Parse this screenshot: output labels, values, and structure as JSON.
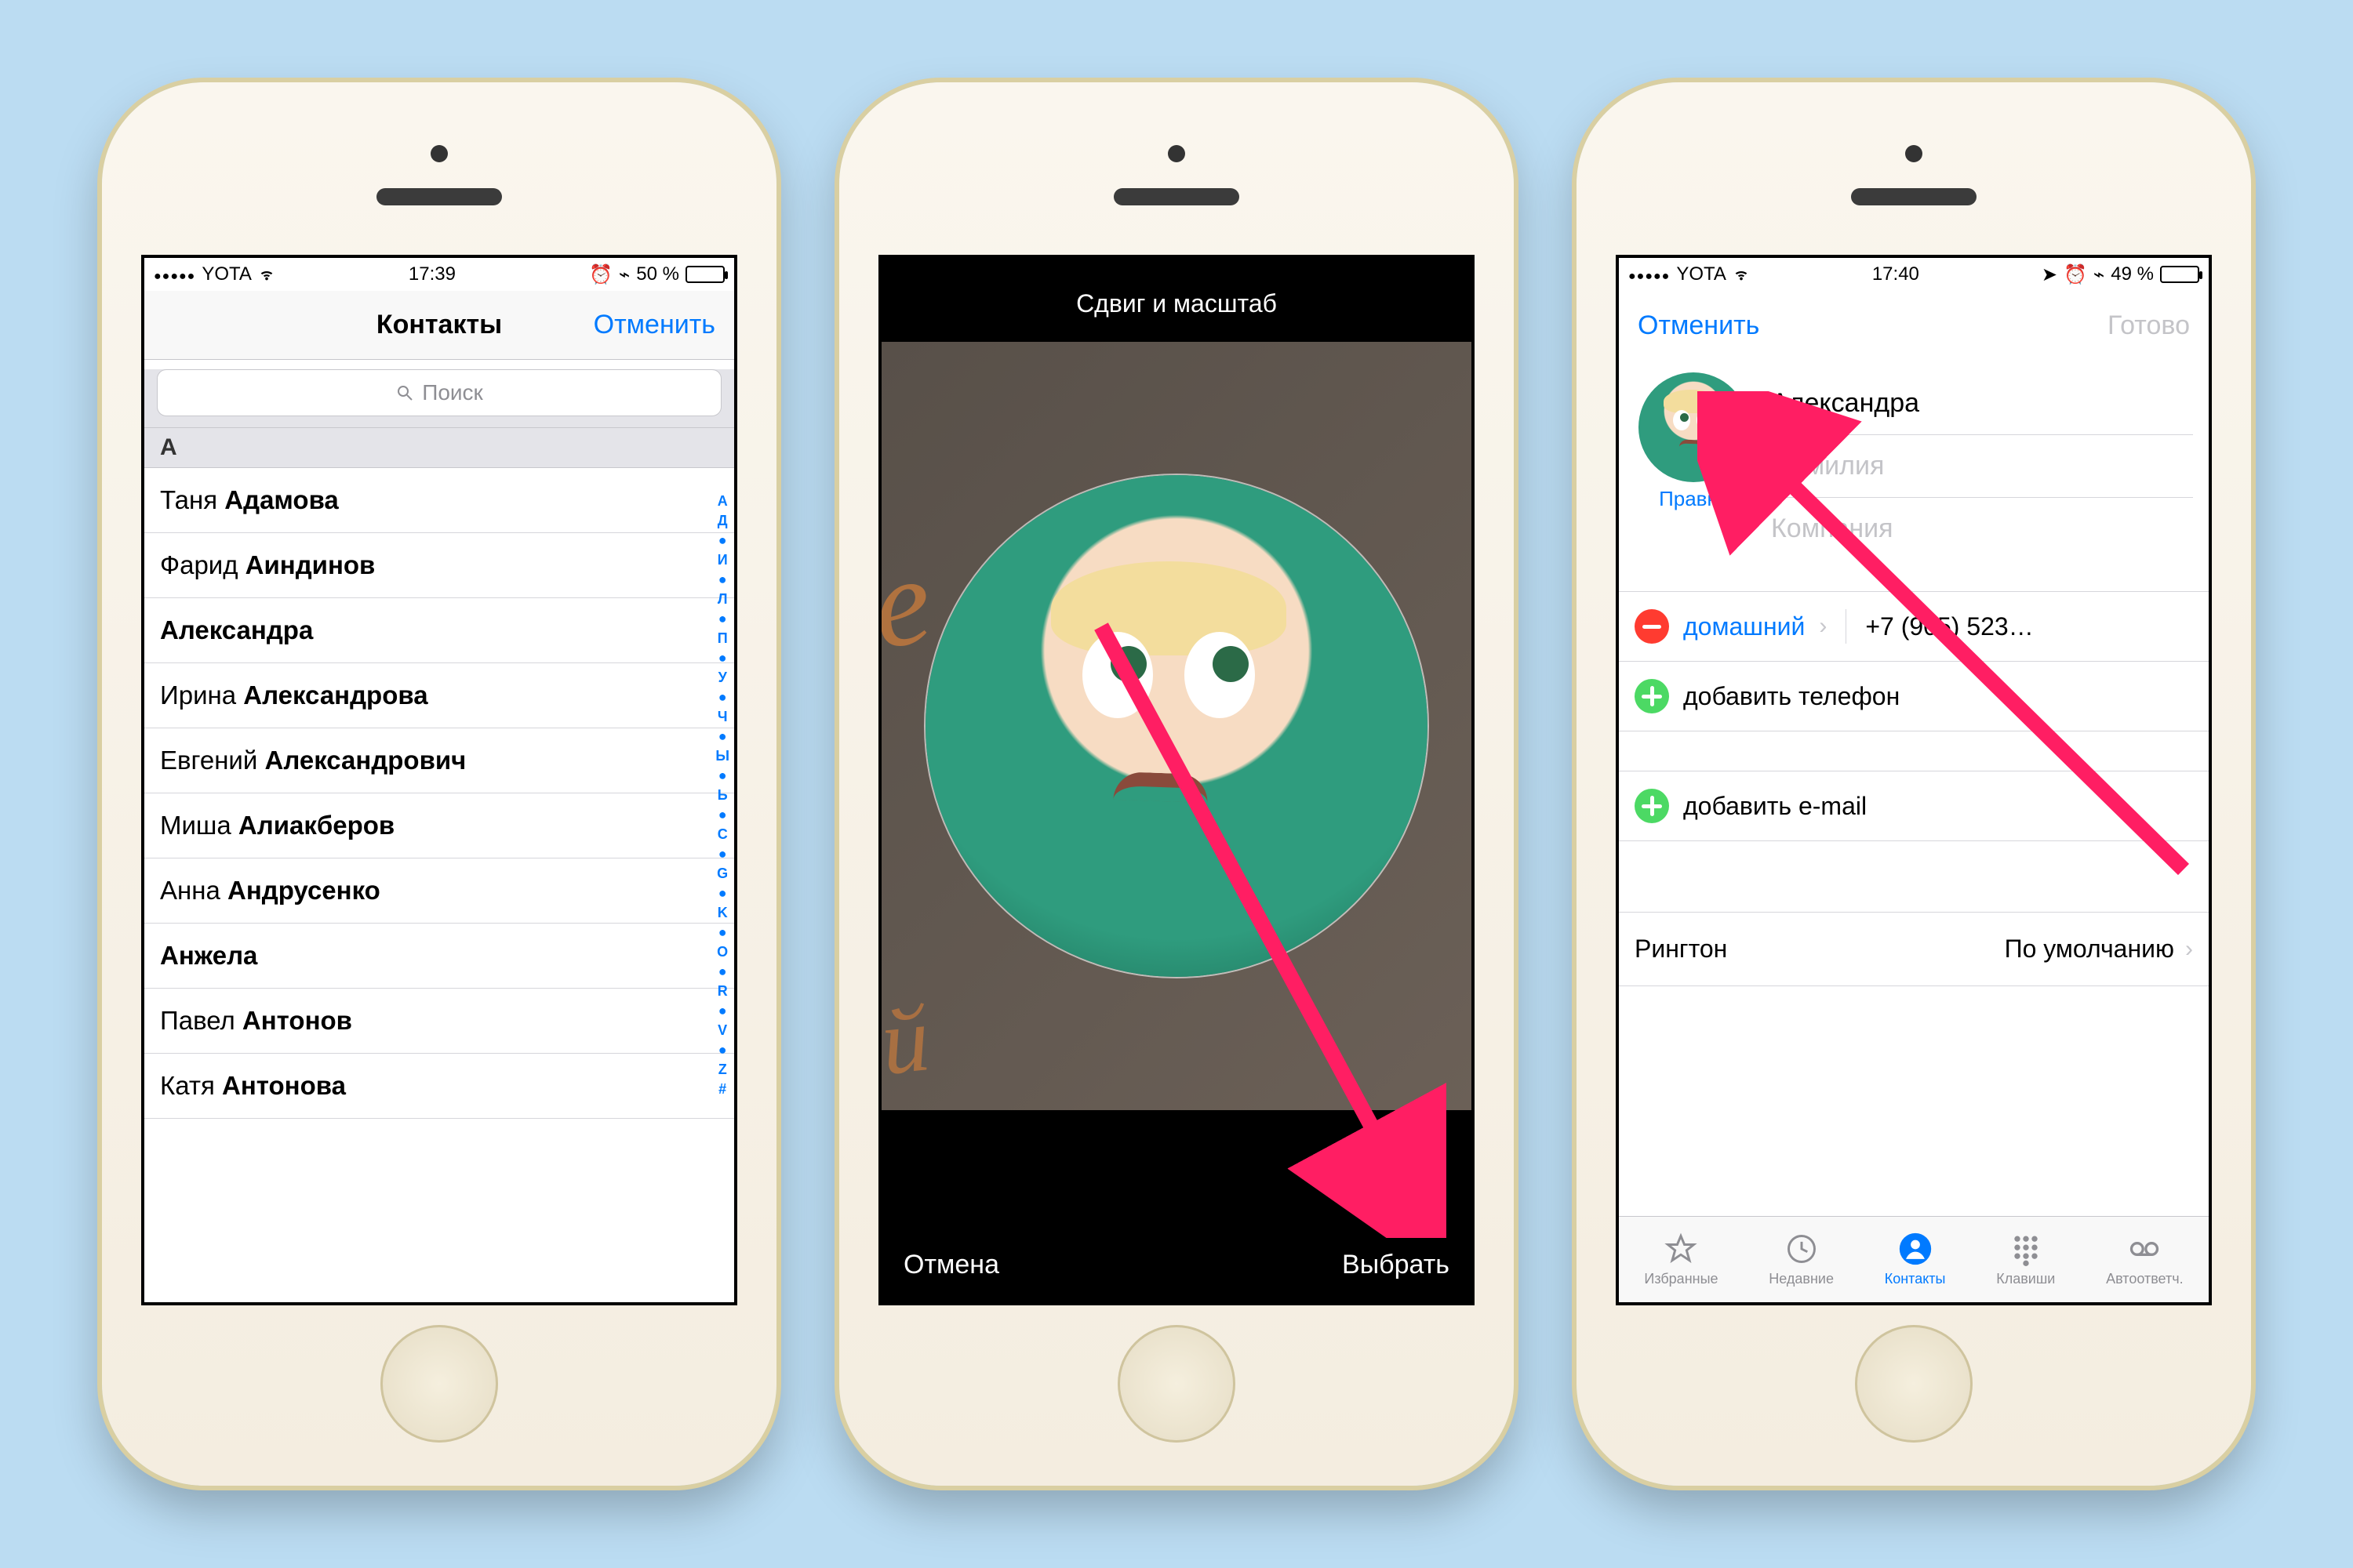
{
  "phone1": {
    "status": {
      "carrier": "YOTA",
      "time": "17:39",
      "battery": "50 %",
      "alarm": true,
      "bt": true
    },
    "nav": {
      "title": "Контакты",
      "cancel": "Отменить"
    },
    "search_placeholder": "Поиск",
    "section": "А",
    "contacts": [
      {
        "first": "Таня",
        "last": "Адамова"
      },
      {
        "first": "Фарид",
        "last": "Аиндинов"
      },
      {
        "single": "Александра"
      },
      {
        "first": "Ирина",
        "last": "Александрова"
      },
      {
        "first": "Евгений",
        "last": "Александрович"
      },
      {
        "first": "Миша",
        "last": "Алиакберов"
      },
      {
        "first": "Анна",
        "last": "Андрусенко"
      },
      {
        "single": "Анжела"
      },
      {
        "first": "Павел",
        "last": "Антонов"
      },
      {
        "first": "Катя",
        "last": "Антонова"
      }
    ],
    "index": [
      "А",
      "Д",
      "●",
      "И",
      "●",
      "Л",
      "●",
      "П",
      "●",
      "У",
      "●",
      "Ч",
      "●",
      "Ы",
      "●",
      "Ь",
      "●",
      "C",
      "●",
      "G",
      "●",
      "K",
      "●",
      "O",
      "●",
      "R",
      "●",
      "V",
      "●",
      "Z",
      "#"
    ]
  },
  "phone2": {
    "title": "Сдвиг и масштаб",
    "cancel": "Отмена",
    "choose": "Выбрать"
  },
  "phone3": {
    "status": {
      "carrier": "YOTA",
      "time": "17:40",
      "battery": "49 %",
      "nav": true,
      "alarm": true,
      "bt": true
    },
    "nav": {
      "cancel": "Отменить",
      "done": "Готово"
    },
    "edit_link": "Правка",
    "first_name": "Александра",
    "placeholder_lastname": "Фамилия",
    "placeholder_company": "Компания",
    "phone_label": "домашний",
    "phone_value": "+7 (905) 523…",
    "add_phone": "добавить телефон",
    "add_email": "добавить e-mail",
    "ringtone_label": "Рингтон",
    "ringtone_value": "По умолчанию",
    "tabs": {
      "fav": "Избранные",
      "recent": "Недавние",
      "contacts": "Контакты",
      "keypad": "Клавиши",
      "voicemail": "Автоответч."
    }
  }
}
